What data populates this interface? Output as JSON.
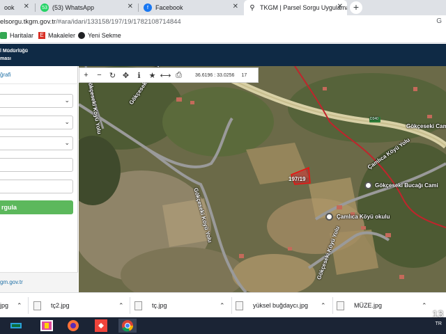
{
  "tabs": [
    {
      "label": "ook",
      "favicon": "facebook-icon"
    },
    {
      "label": "(53) WhatsApp",
      "badge": "53",
      "favicon": "whatsapp-icon"
    },
    {
      "label": "Facebook",
      "favicon": "facebook-icon"
    },
    {
      "label": "TKGM | Parsel Sorgu Uygulaması",
      "favicon": "location-pin-icon",
      "active": true
    }
  ],
  "address_bar": {
    "url_host": "elsorgu.tkgm.gov.tr",
    "url_path": "/#ara/idari/133158/197/19/1782108714844"
  },
  "bookmarks": [
    {
      "label": "Haritalar",
      "icon": "maps-icon"
    },
    {
      "label": "Makaleler",
      "icon": "bookmark-e-icon"
    },
    {
      "label": "Yeni Sekme",
      "icon": "globe-icon"
    }
  ],
  "header": {
    "line1": "l Müdürlüğü",
    "line2": "ması"
  },
  "sidebar": {
    "title": "ğrafi",
    "search_button": "rgula",
    "footer_link": "gm.gov.tr"
  },
  "map": {
    "coords": "36.6196 : 33.0256",
    "zoom": "17",
    "parcel_label": "197/19",
    "labels": {
      "road1": "Gökçeseki Köyü Yolu",
      "road2": "Gökçeseki Köyü Yolu",
      "road3": "Gökçeseki Köyü Yolu",
      "road4": "Çamlıca Köyü Yolu",
      "road5": "Gökçeseki Köyü Yolu",
      "mosque": "Gökçeseki Bucağı Cami",
      "school": "Çamlıca Köyü okulu",
      "village": "Gökçeseki Cami",
      "road_sign": "D340"
    }
  },
  "downloads": [
    {
      "name": "jpg"
    },
    {
      "name": "tç2.jpg"
    },
    {
      "name": "tç.jpg"
    },
    {
      "name": "yüksel buğdaycı.jpg"
    },
    {
      "name": "MÜZE.jpg"
    }
  ],
  "taskbar": {
    "time": "13",
    "lang": "TR"
  }
}
